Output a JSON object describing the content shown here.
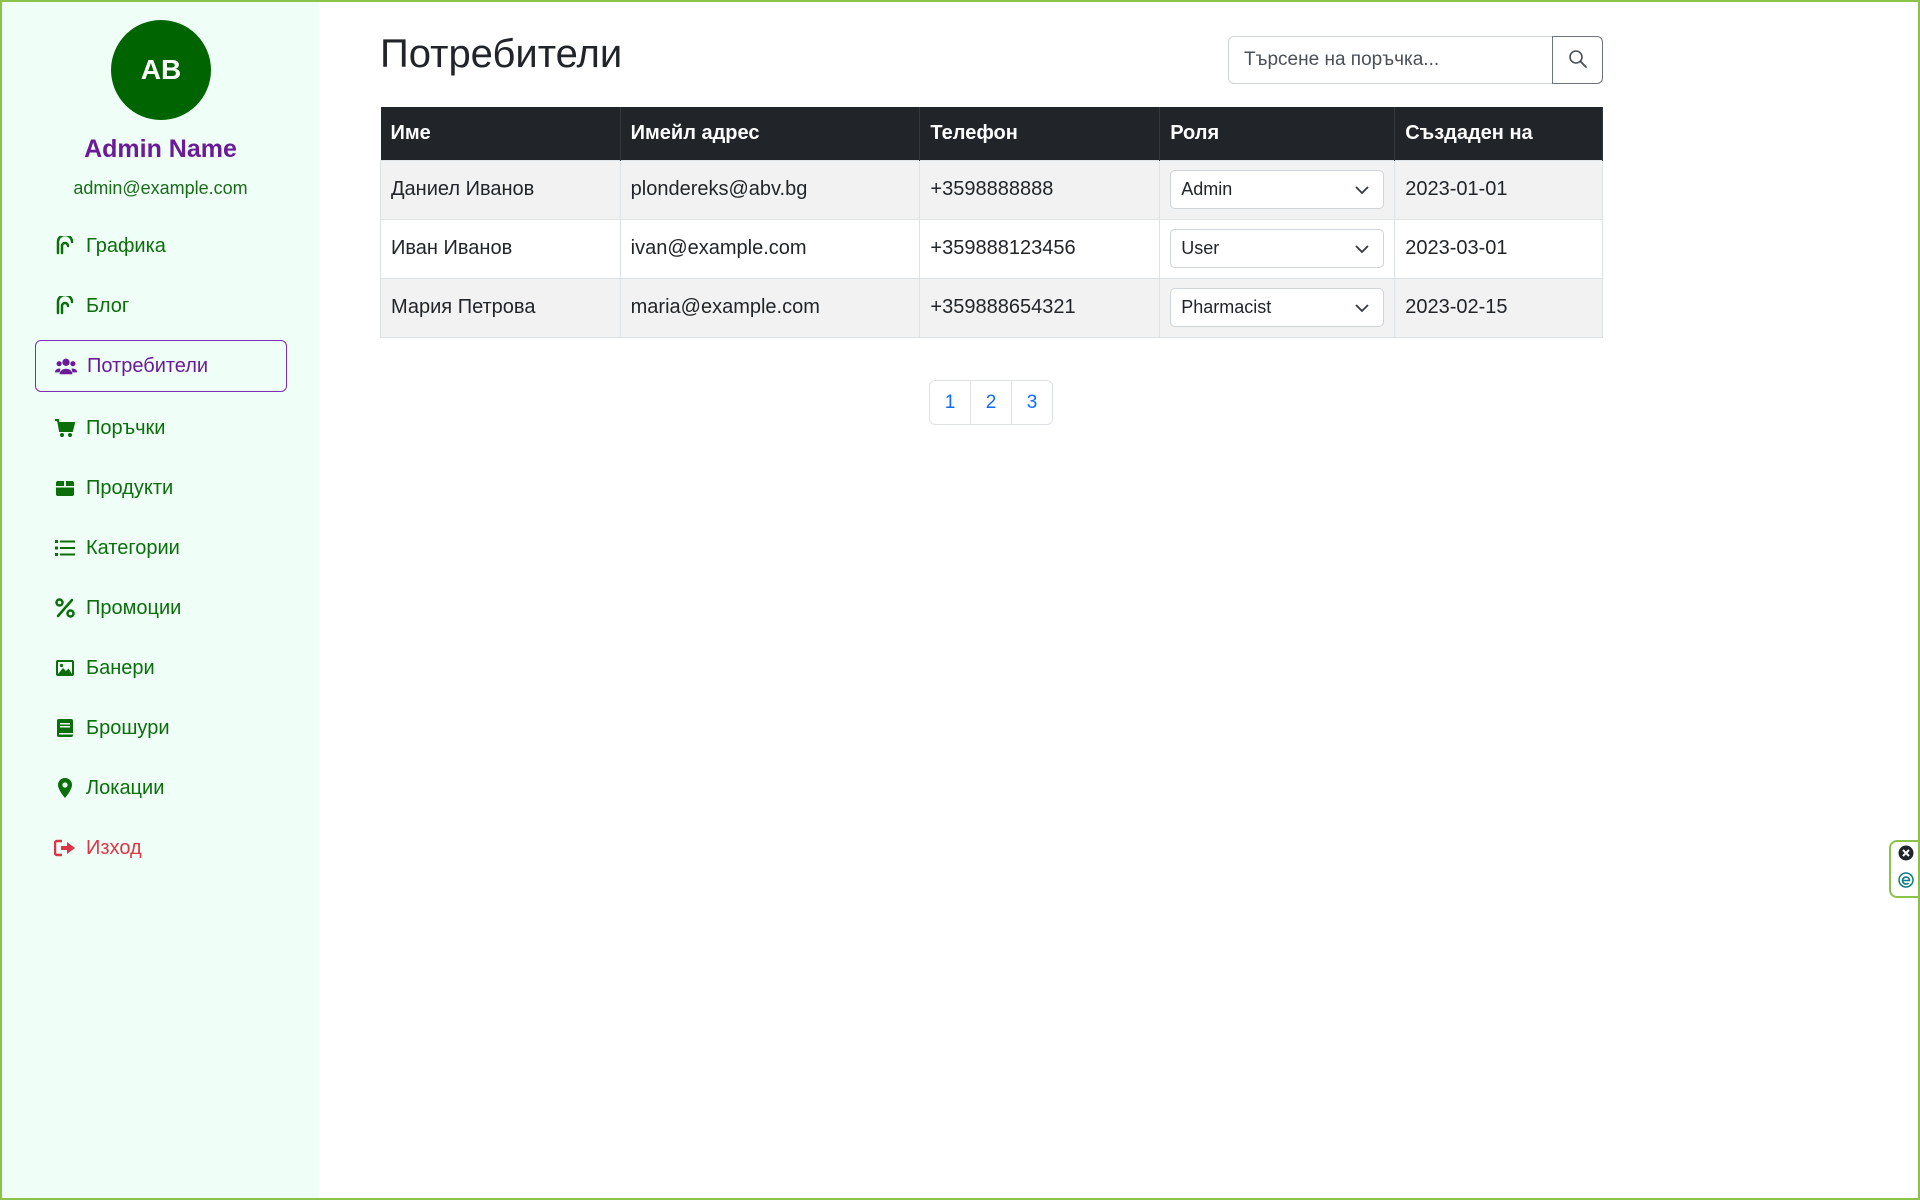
{
  "user": {
    "initials": "AB",
    "name": "Admin Name",
    "email": "admin@example.com"
  },
  "nav": {
    "items": [
      {
        "label": "Графика",
        "icon": "chart-icon"
      },
      {
        "label": "Блог",
        "icon": "blog-icon"
      },
      {
        "label": "Потребители",
        "icon": "users-icon",
        "active": true
      },
      {
        "label": "Поръчки",
        "icon": "cart-icon"
      },
      {
        "label": "Продукти",
        "icon": "box-icon"
      },
      {
        "label": "Категории",
        "icon": "list-icon"
      },
      {
        "label": "Промоции",
        "icon": "percent-icon"
      },
      {
        "label": "Банери",
        "icon": "image-icon"
      },
      {
        "label": "Брошури",
        "icon": "book-icon"
      },
      {
        "label": "Локации",
        "icon": "location-pin-icon"
      },
      {
        "label": "Изход",
        "icon": "logout-icon"
      }
    ]
  },
  "page": {
    "title": "Потребители"
  },
  "search": {
    "placeholder": "Търсене на поръчка..."
  },
  "table": {
    "headers": [
      "Име",
      "Имейл адрес",
      "Телефон",
      "Роля",
      "Създаден на"
    ],
    "rows": [
      {
        "name": "Даниел Иванов",
        "email": "plondereks@abv.bg",
        "phone": "+3598888888",
        "role": "Admin",
        "created": "2023-01-01"
      },
      {
        "name": "Иван Иванов",
        "email": "ivan@example.com",
        "phone": "+359888123456",
        "role": "User",
        "created": "2023-03-01"
      },
      {
        "name": "Мария Петрова",
        "email": "maria@example.com",
        "phone": "+359888654321",
        "role": "Pharmacist",
        "created": "2023-02-15"
      }
    ]
  },
  "pagination": {
    "pages": [
      "1",
      "2",
      "3"
    ]
  },
  "colors": {
    "sidebar_bg": "#effff8",
    "accent_green": "#006400",
    "accent_purple": "#6a1b9a",
    "logout_red": "#dc3545",
    "link_blue": "#0d6efd"
  }
}
